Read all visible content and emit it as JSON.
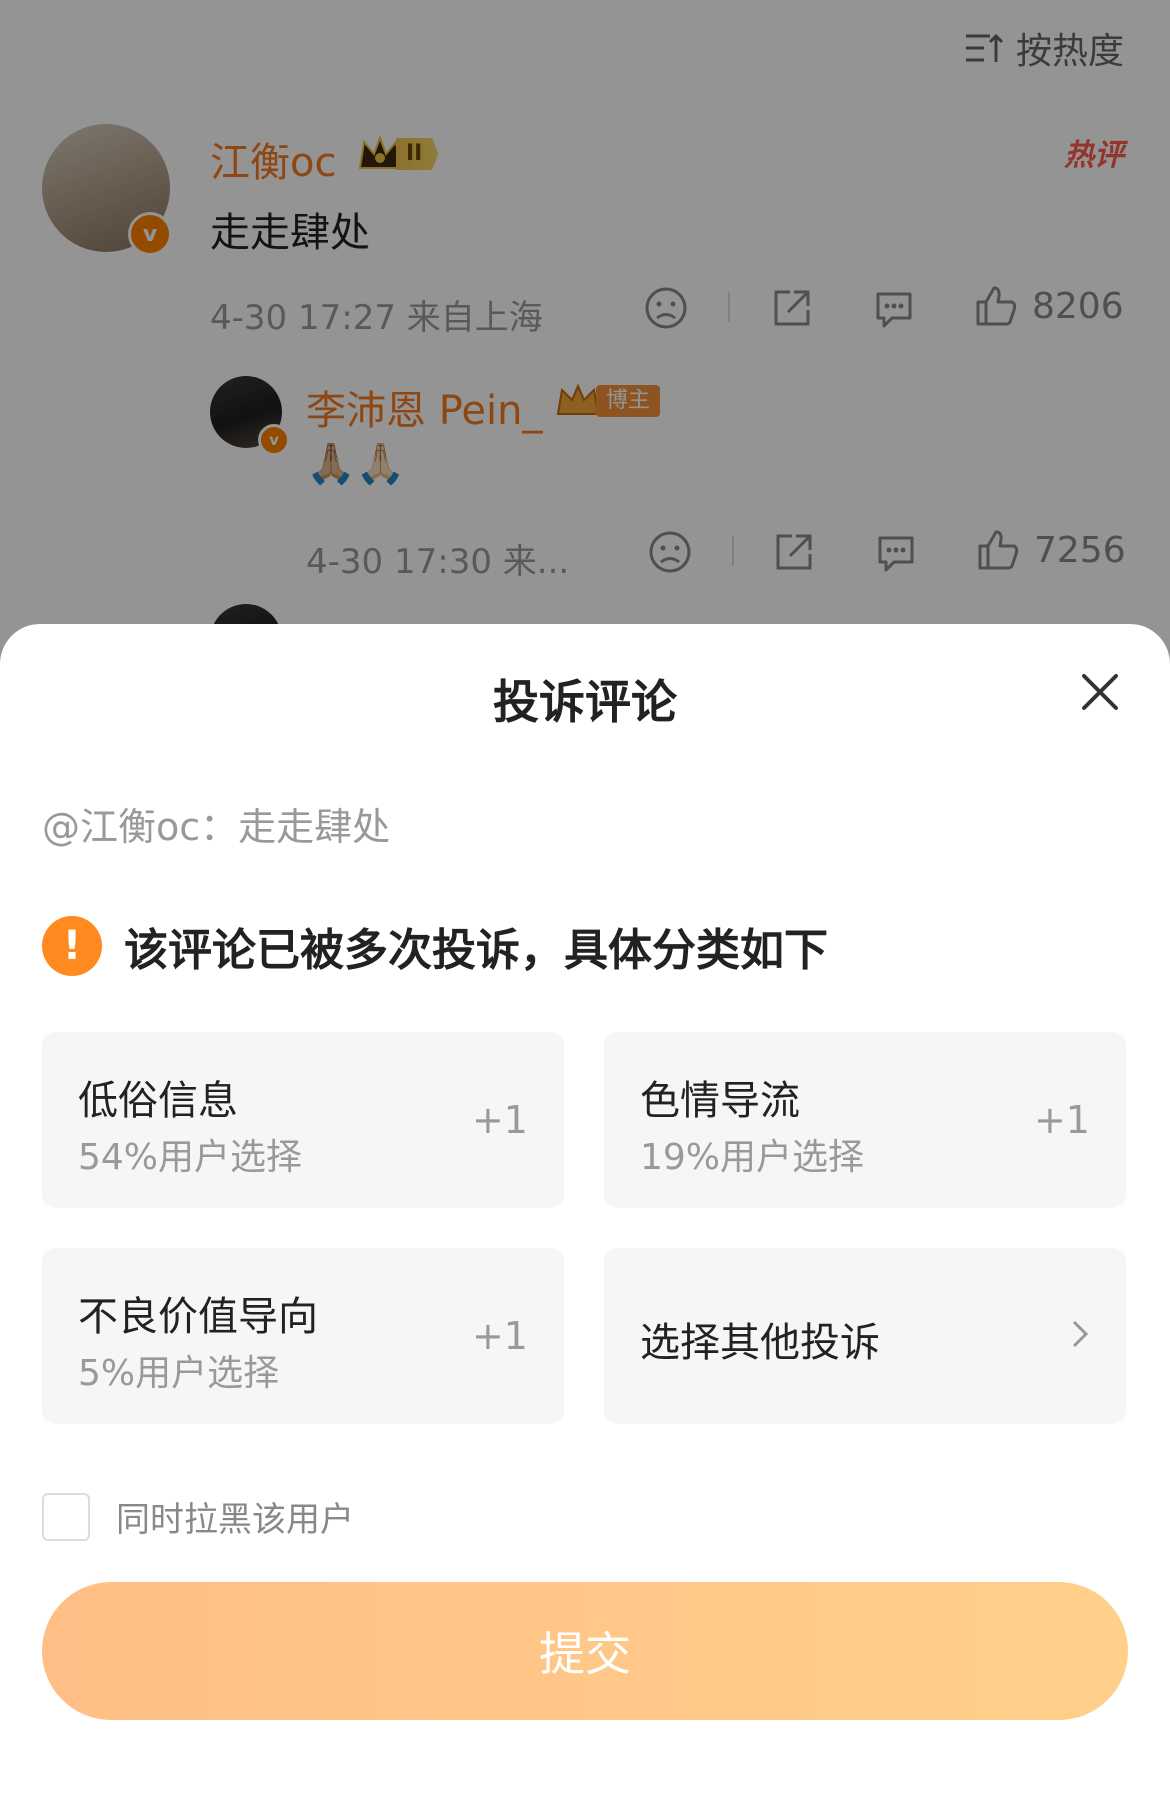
{
  "feed": {
    "sort_label": "按热度",
    "comments": [
      {
        "username": "江衡oc",
        "level_badge": "II",
        "hot_tag": "热评",
        "text": "走走肆处",
        "meta": "4-30 17:27 来自上海",
        "likes": "8206"
      },
      {
        "username": "李沛恩 Pein_",
        "role_badge": "博主",
        "text": "🙏🏼🙏🏻",
        "meta": "4-30 17:30 来...",
        "likes": "7256"
      }
    ]
  },
  "sheet": {
    "title": "投诉评论",
    "quote": "@江衡oc：走走肆处",
    "warning": "该评论已被多次投诉，具体分类如下",
    "options": [
      {
        "label": "低俗信息",
        "percent": "54%用户选择",
        "plus": "+1"
      },
      {
        "label": "色情导流",
        "percent": "19%用户选择",
        "plus": "+1"
      },
      {
        "label": "不良价值导向",
        "percent": "5%用户选择",
        "plus": "+1"
      },
      {
        "label": "选择其他投诉"
      }
    ],
    "block_label": "同时拉黑该用户",
    "submit_label": "提交"
  },
  "colors": {
    "accent": "#ff8a1f",
    "username": "#f47a20",
    "submit_start": "#ffbe85",
    "submit_end": "#ffd08a"
  }
}
